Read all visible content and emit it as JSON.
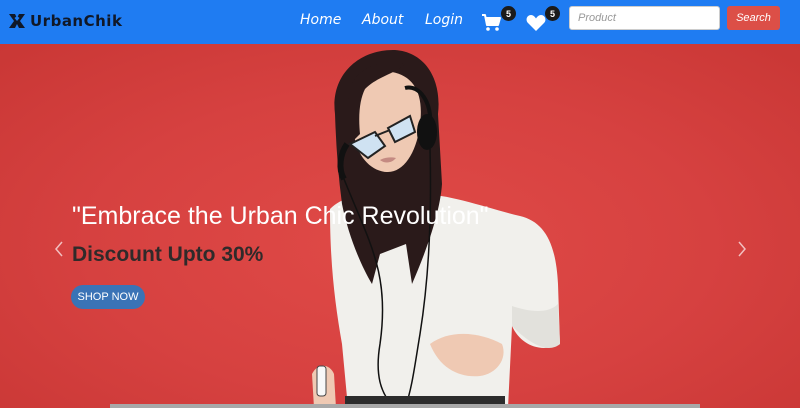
{
  "brand": {
    "name": "UrbanChik"
  },
  "nav": {
    "home": "Home",
    "about": "About",
    "login": "Login",
    "cart_count": "5",
    "wishlist_count": "5"
  },
  "search": {
    "placeholder": "Product",
    "button_label": "Search"
  },
  "hero": {
    "title": "\"Embrace the Urban Chic Revolution\"",
    "subtitle": "Discount Upto 30%",
    "cta_label": "SHOP NOW"
  },
  "colors": {
    "navbar": "#1f7cf2",
    "hero_background": "#d94343",
    "search_button": "#dc4f47",
    "cta_button": "#3a73b6"
  },
  "icons": {
    "brand": "brand-logo-icon",
    "cart": "cart-icon",
    "wishlist": "heart-icon",
    "prev": "chevron-left-icon",
    "next": "chevron-right-icon"
  }
}
